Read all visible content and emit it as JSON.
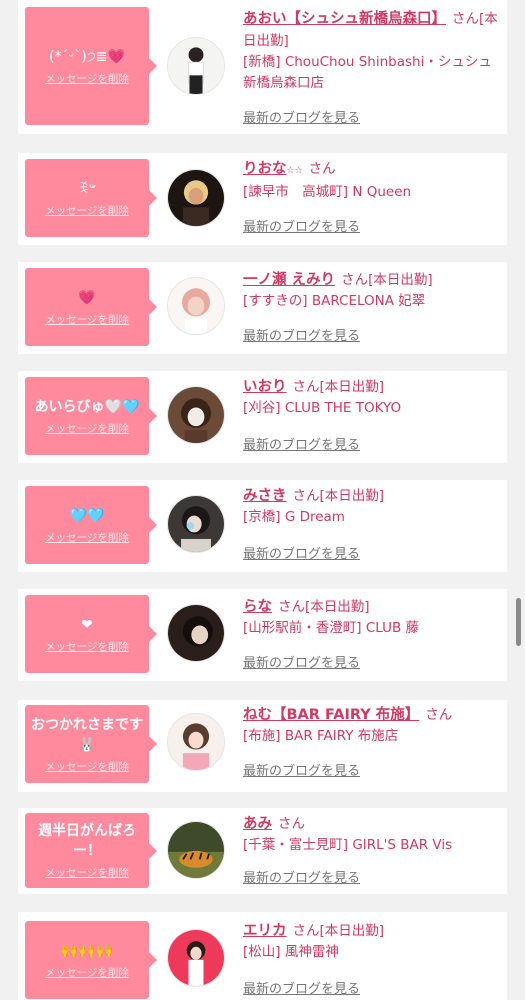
{
  "ui": {
    "delete_label": "メッセージを削除",
    "blog_label": "最新のブログを見る",
    "san": "さん",
    "today": "[本日出勤]"
  },
  "colors": {
    "accent": "#d13a63",
    "bubble": "#ff8a9e",
    "background": "#f1f1f1"
  },
  "messages": [
    {
      "message": "(*ˊᵕˋ)੭≣💗",
      "name": "あおい【シュシュ新橋烏森口】",
      "today": true,
      "shop": "[新橋] ChouChou Shinbashi・シュシュ新橋烏森口店",
      "avatar": "avatar-woman-white-top-icon"
    },
    {
      "message": "ꉂ𐤔",
      "name": "りおな",
      "stars": "☆☆",
      "today": false,
      "shop": "[諫早市　高城町] N Queen",
      "avatar": "avatar-woman-blonde-icon"
    },
    {
      "message": "💗",
      "name": "一ノ瀬 えみり",
      "today": true,
      "shop": "[すすきの] BARCELONA 妃翠",
      "avatar": "avatar-woman-pink-hair-icon"
    },
    {
      "message": "あいらびゅ🤍🩵",
      "name": "いおり",
      "today": true,
      "shop": "[刈谷] CLUB THE TOKYO",
      "avatar": "avatar-woman-brown-hair-icon"
    },
    {
      "message": "🩵🩵",
      "name": "みさき",
      "today": true,
      "shop": "[京橋] G Dream",
      "avatar": "avatar-woman-blurred-icon"
    },
    {
      "message": "❤",
      "name": "らな",
      "today": true,
      "shop": "[山形駅前・香澄町] CLUB 藤",
      "avatar": "avatar-woman-dark-icon"
    },
    {
      "message": "おつかれさまです🐰",
      "name": "ねむ【BAR FAIRY 布施】",
      "today": false,
      "shop": "[布施] BAR FAIRY 布施店",
      "avatar": "avatar-woman-pink-outfit-icon"
    },
    {
      "message": "週半日がんばろー！",
      "name": "あみ",
      "today": false,
      "shop": "[千葉・富士見町] GIRL'S BAR Vis",
      "avatar": "avatar-tiger-photo-icon"
    },
    {
      "message": "🙌🙌🙌",
      "name": "エリカ",
      "today": true,
      "shop": "[松山] 風神雷神",
      "avatar": "avatar-woman-red-background-icon"
    }
  ]
}
